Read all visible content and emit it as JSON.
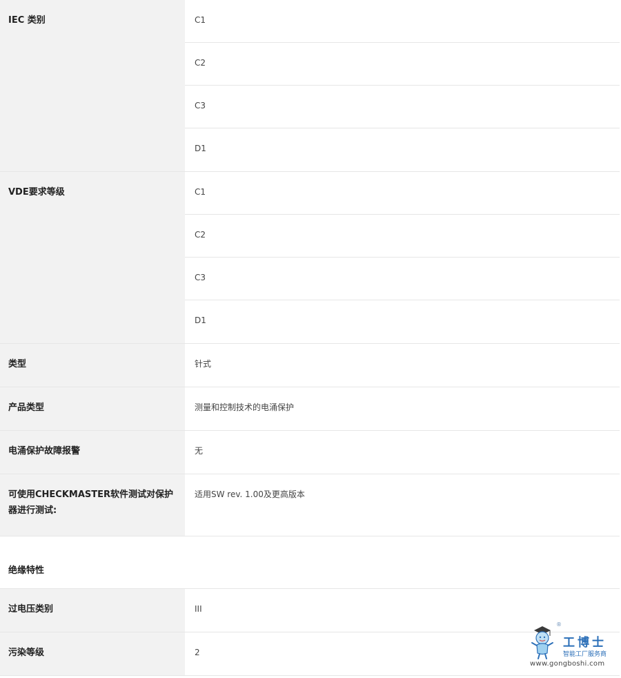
{
  "groups": [
    {
      "label": "IEC 类别",
      "values": [
        "C1",
        "C2",
        "C3",
        "D1"
      ]
    },
    {
      "label": "VDE要求等级",
      "values": [
        "C1",
        "C2",
        "C3",
        "D1"
      ]
    }
  ],
  "rows": [
    {
      "label": "类型",
      "value": "针式"
    },
    {
      "label": "产品类型",
      "value": "测量和控制技术的电涌保护"
    },
    {
      "label": "电涌保护故障报警",
      "value": "无"
    },
    {
      "label": "可使用CHECKMASTER软件测试对保护器进行测试:",
      "value": "适用SW rev. 1.00及更高版本"
    }
  ],
  "section": {
    "heading": "绝缘特性",
    "rows": [
      {
        "label": "过电压类别",
        "value": "III"
      },
      {
        "label": "污染等级",
        "value": "2"
      }
    ]
  },
  "watermark": {
    "title": "工博士",
    "registered": "®",
    "tagline": "智能工厂服务商",
    "url": "www.gongboshi.com",
    "color": "#2b6fb8"
  }
}
